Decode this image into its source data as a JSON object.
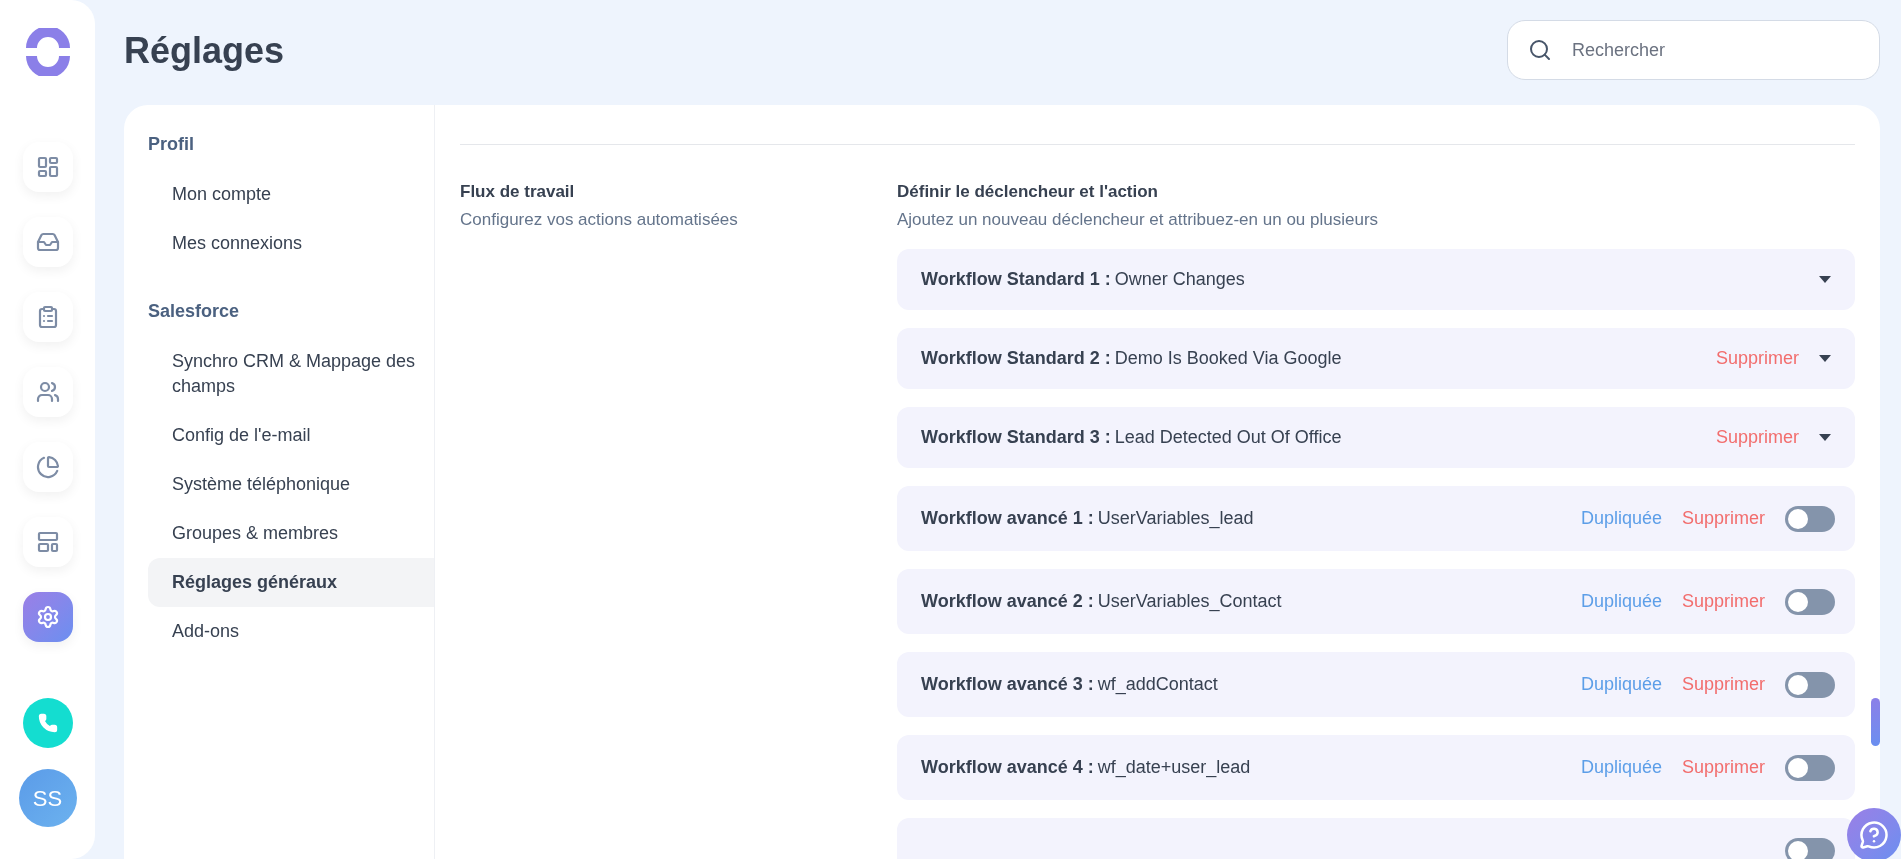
{
  "rail": {
    "items": [
      {
        "kind": "dashboard",
        "selected": false
      },
      {
        "kind": "inbox",
        "selected": false
      },
      {
        "kind": "tasks",
        "selected": false
      },
      {
        "kind": "team",
        "selected": false
      },
      {
        "kind": "reports",
        "selected": false
      },
      {
        "kind": "layout",
        "selected": false
      },
      {
        "kind": "settings",
        "selected": true
      }
    ],
    "avatar": "SS"
  },
  "title": "Réglages",
  "search": {
    "placeholder": "Rechercher"
  },
  "nav": [
    {
      "heading": "Profil",
      "items": [
        {
          "label": "Mon compte",
          "selected": false
        },
        {
          "label": "Mes connexions",
          "selected": false
        }
      ]
    },
    {
      "heading": "Salesforce",
      "items": [
        {
          "label": "Synchro CRM & Mappage des champs",
          "selected": false
        },
        {
          "label": "Config de l'e-mail",
          "selected": false
        },
        {
          "label": "Système téléphonique",
          "selected": false
        },
        {
          "label": "Groupes & membres",
          "selected": false
        },
        {
          "label": "Réglages généraux",
          "selected": true
        },
        {
          "label": "Add-ons",
          "selected": false
        }
      ]
    }
  ],
  "section": {
    "title": "Flux de travail",
    "description": "Configurez vos actions automatisées"
  },
  "workflows_header": {
    "title": "Définir le déclencheur et l'action",
    "description": "Ajoutez un nouveau déclencheur et attribuez-en un ou plusieurs"
  },
  "workflows": [
    {
      "kind": "standard",
      "label": "Workflow Standard 1 :",
      "name": "Owner Changes"
    },
    {
      "kind": "standard",
      "label": "Workflow Standard 2 :",
      "name": "Demo Is Booked Via Google",
      "delete": "Supprimer"
    },
    {
      "kind": "standard",
      "label": "Workflow Standard 3 :",
      "name": "Lead Detected Out Of Office",
      "delete": "Supprimer"
    },
    {
      "kind": "advanced",
      "label": "Workflow avancé 1 :",
      "name": "UserVariables_lead",
      "duplicate": "Dupliquée",
      "delete": "Supprimer",
      "on": false
    },
    {
      "kind": "advanced",
      "label": "Workflow avancé 2 :",
      "name": "UserVariables_Contact",
      "duplicate": "Dupliquée",
      "delete": "Supprimer",
      "on": false
    },
    {
      "kind": "advanced",
      "label": "Workflow avancé 3 :",
      "name": "wf_addContact",
      "duplicate": "Dupliquée",
      "delete": "Supprimer",
      "on": false
    },
    {
      "kind": "advanced",
      "label": "Workflow avancé 4 :",
      "name": "wf_date+user_lead",
      "duplicate": "Dupliquée",
      "delete": "Supprimer",
      "on": false
    },
    {
      "kind": "advanced",
      "on": false
    }
  ]
}
